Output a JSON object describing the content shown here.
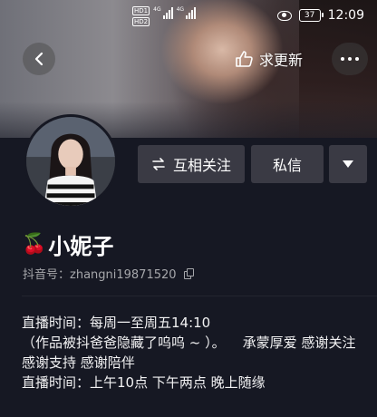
{
  "status_bar": {
    "time": "12:09",
    "battery": "37",
    "hd_label": "HD",
    "sim1": "1",
    "sim2": "2",
    "network1": "4G",
    "network2": "4G"
  },
  "header": {
    "update_label": "求更新"
  },
  "profile": {
    "name": "小妮子",
    "name_emoji": "🍒",
    "douyin_id": "抖音号：zhangni19871520",
    "follow_label": "互相关注",
    "message_label": "私信"
  },
  "bio": {
    "lines": [
      "直播时间：每周一至周五14:10",
      "（作品被抖爸爸隐藏了呜呜 ~ ）。    承蒙厚爱 感谢关注",
      "感谢支持 感谢陪伴",
      "直播时间：上午10点 下午两点 晚上随缘"
    ]
  },
  "colors": {
    "background": "#161823",
    "button": "#3a3a44",
    "secondary_text": "#a6a7ab"
  }
}
